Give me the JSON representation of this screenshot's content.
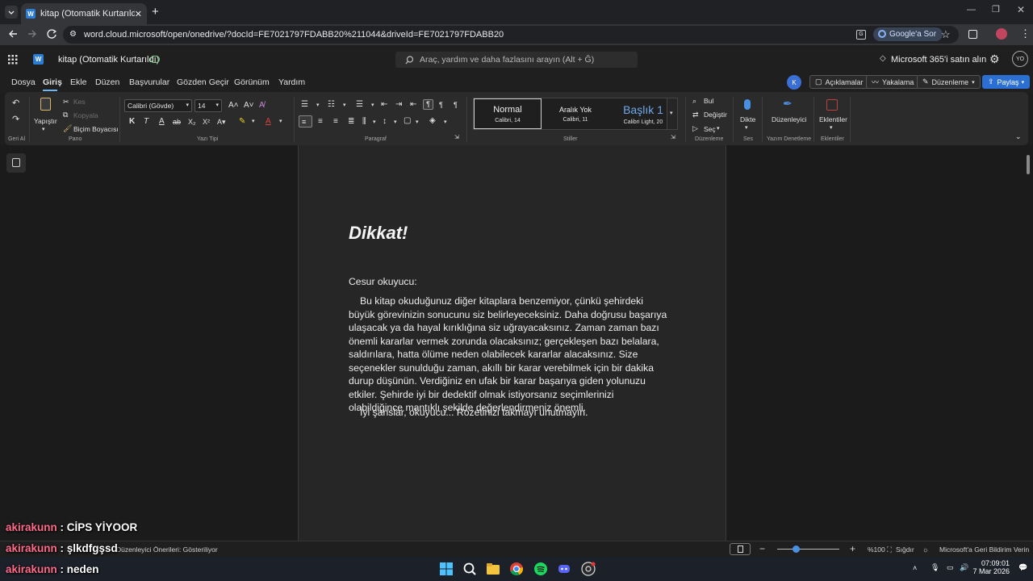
{
  "browser": {
    "tab_title": "kitap (Otomatik Kurtarıldı).docx",
    "url": "word.cloud.microsoft/open/onedrive/?docId=FE7021797FDABB20%211044&driveId=FE7021797FDABB20",
    "google_sor": "Google'a Sor"
  },
  "word": {
    "app_icon": "W",
    "doc_title": "kitap (Otomatik Kurtarıldı)",
    "search_placeholder": "Araç, yardım ve daha fazlasını arayın (Alt + Ğ)",
    "m365": "Microsoft 365'i satın alın",
    "avatar": "YO",
    "collab_avatar": "K"
  },
  "menu": {
    "items": [
      "Dosya",
      "Giriş",
      "Ekle",
      "Düzen",
      "Başvurular",
      "Gözden Geçir",
      "Görünüm",
      "Yardım"
    ],
    "active": "Giriş",
    "comments": "Açıklamalar",
    "catchup": "Yakalama",
    "editing": "Düzenleme",
    "share": "Paylaş"
  },
  "ribbon": {
    "undo_group": "Geri Al",
    "paste": "Yapıştır",
    "cut": "Kes",
    "copy": "Kopyala",
    "format_painter": "Biçim Boyacısı",
    "clipboard_group": "Pano",
    "font_name": "Calibri (Gövde)",
    "font_size": "14",
    "font_group": "Yazı Tipi",
    "bold": "K",
    "italic": "T",
    "underline": "A",
    "strike": "ab",
    "subscript": "X₂",
    "superscript": "X²",
    "paragraph_group": "Paragraf",
    "styles": [
      {
        "name": "Normal",
        "desc": "Calibri, 14"
      },
      {
        "name": "Aralık Yok",
        "desc": "Calibri, 11"
      },
      {
        "name": "Başlık 1",
        "desc": "Calibri Light, 20"
      }
    ],
    "styles_group": "Stiller",
    "find": "Bul",
    "replace": "Değiştir",
    "select": "Seç",
    "editing_group": "Düzenleme",
    "dictate": "Dikte",
    "voice_group": "Ses",
    "editor": "Düzenleyici",
    "proofing_group": "Yazım Denetleme",
    "addins": "Eklentiler",
    "addins_group": "Eklentiler"
  },
  "document": {
    "heading": "Dikkat!",
    "salutation": "Cesur okuyucu:",
    "body": "Bu kitap okuduğunuz diğer kitaplara benzemiyor, çünkü şehirdeki büyük görevinizin sonucunu siz belirleyeceksiniz. Daha doğrusu başarıya ulaşacak ya da hayal kırıklığına siz uğrayacaksınız. Zaman zaman bazı önemli kararlar vermek zorunda olacaksınız; gerçekleşen bazı belalara, saldırılara, hatta ölüme neden olabilecek kararlar alacaksınız. Size seçenekler sunulduğu zaman, akıllı bir karar verebilmek için bir dakika durup düşünün. Verdiğiniz en ufak bir karar başarıya giden yolunuzu etkiler. Şehirde iyi bir dedektif olmak istiyorsanız seçimlerinizi olabildiğince mantıklı şekilde değerlendirmeniz önemli.",
    "closing": "İyi şanslar, okuyucu... Rozetinizi takmayı unutmayın."
  },
  "status": {
    "editor_suggestions": "Düzenleyici Önerileri: Gösteriliyor",
    "zoom_minus": "−",
    "zoom_plus": "+",
    "zoom": "%100",
    "fit": "Sığdır",
    "feedback": "Microsoft'a Geri Bildirim Verin",
    "zoom_level": 0.3
  },
  "chat": [
    {
      "user": "akirakunn",
      "msg": "CİPS YİYOOR"
    },
    {
      "user": "akirakunn",
      "msg": "şlkdfgşsd"
    },
    {
      "user": "akirakunn",
      "msg": "neden"
    }
  ],
  "taskbar": {
    "time": "07:09:01",
    "date": "7 Mar 2026"
  },
  "colors": {
    "accent": "#2b6fd3",
    "chat_user": "#ff6b8b",
    "word_blue": "#2b7cd3"
  }
}
